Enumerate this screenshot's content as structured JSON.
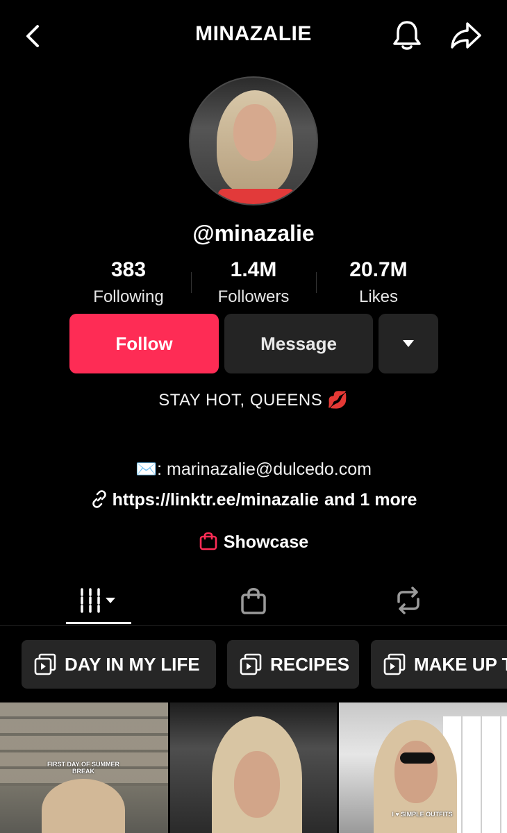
{
  "header": {
    "title": "MINAZALIE",
    "back_icon": "chevron-left-icon",
    "bell_icon": "bell-icon",
    "share_icon": "share-arrow-icon"
  },
  "profile": {
    "username": "@minazalie",
    "stats": [
      {
        "value": "383",
        "label": "Following"
      },
      {
        "value": "1.4M",
        "label": "Followers"
      },
      {
        "value": "20.7M",
        "label": "Likes"
      }
    ],
    "buttons": {
      "follow": "Follow",
      "message": "Message"
    },
    "bio": "STAY HOT, QUEENS 💋",
    "email": "✉️: marinazalie@dulcedo.com",
    "link": "https://linktr.ee/minazalie",
    "link_more": "and 1 more",
    "showcase": "Showcase"
  },
  "tabs": [
    {
      "icon": "videos-grid-icon"
    },
    {
      "icon": "shopping-bag-icon"
    },
    {
      "icon": "repost-icon"
    }
  ],
  "playlists": [
    {
      "label": "DAY IN MY LIFE"
    },
    {
      "label": "RECIPES"
    },
    {
      "label": "MAKE UP T"
    }
  ],
  "thumbnails": [
    {
      "caption": "FIRST DAY OF SUMMER BREAK"
    },
    {
      "caption": ""
    },
    {
      "caption": "I ♥ SIMPLE OUTFITS"
    }
  ],
  "colors": {
    "background": "#000000",
    "follow_button": "#fe2c55",
    "secondary_button": "#242424"
  }
}
